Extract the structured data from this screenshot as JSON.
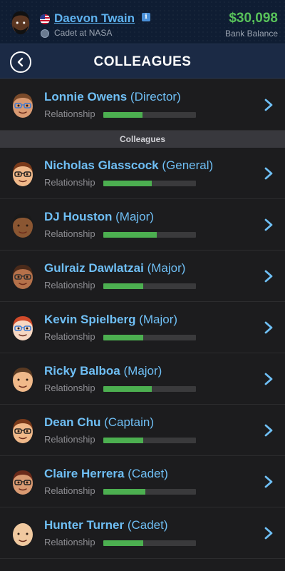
{
  "player": {
    "name": "Daevon Twain",
    "job": "Cadet at NASA",
    "balance": "$30,098",
    "balance_label": "Bank Balance"
  },
  "header": {
    "title": "COLLEAGUES"
  },
  "boss": {
    "name": "Lonnie Owens",
    "rank": "(Director)",
    "relationship_label": "Relationship",
    "relationship": 0.42,
    "skin": "#d99a72",
    "hair": "#7a4a2a",
    "glasses": "#3b7bd6"
  },
  "section_label": "Colleagues",
  "colleagues": [
    {
      "name": "Nicholas Glasscock",
      "rank": "(General)",
      "relationship_label": "Relationship",
      "relationship": 0.52,
      "skin": "#f0b98a",
      "hair": "#7a3a1a",
      "glasses": "#222"
    },
    {
      "name": "DJ Houston",
      "rank": "(Major)",
      "relationship_label": "Relationship",
      "relationship": 0.58,
      "skin": "#8a5632",
      "hair": "#1a1a1a",
      "glasses": ""
    },
    {
      "name": "Gulraiz Dawlatzai",
      "rank": "(Major)",
      "relationship_label": "Relationship",
      "relationship": 0.43,
      "skin": "#b5714a",
      "hair": "#4a2a1a",
      "glasses": "#333"
    },
    {
      "name": "Kevin Spielberg",
      "rank": "(Major)",
      "relationship_label": "Relationship",
      "relationship": 0.43,
      "skin": "#f7d7c2",
      "hair": "#d04a2a",
      "glasses": "#3b7bd6"
    },
    {
      "name": "Ricky Balboa",
      "rank": "(Major)",
      "relationship_label": "Relationship",
      "relationship": 0.52,
      "skin": "#f0b98a",
      "hair": "#5a3a22",
      "glasses": ""
    },
    {
      "name": "Dean Chu",
      "rank": "(Captain)",
      "relationship_label": "Relationship",
      "relationship": 0.43,
      "skin": "#f0b98a",
      "hair": "#7a3a1a",
      "glasses": "#222"
    },
    {
      "name": "Claire Herrera",
      "rank": "(Cadet)",
      "relationship_label": "Relationship",
      "relationship": 0.45,
      "skin": "#d99a72",
      "hair": "#6a2a1a",
      "glasses": "#222"
    },
    {
      "name": "Hunter Turner",
      "rank": "(Cadet)",
      "relationship_label": "Relationship",
      "relationship": 0.43,
      "skin": "#f0c9a0",
      "hair": "",
      "glasses": ""
    }
  ],
  "colors": {
    "accent": "#6fbff5",
    "money": "#58c25a",
    "bar_fill": "#4caf50",
    "bar_track": "#3a3a3c"
  },
  "icons": {
    "back": "chevron-left-circle-icon",
    "row": "chevron-right-icon",
    "info": "info-icon",
    "flag": "us-flag-icon"
  }
}
